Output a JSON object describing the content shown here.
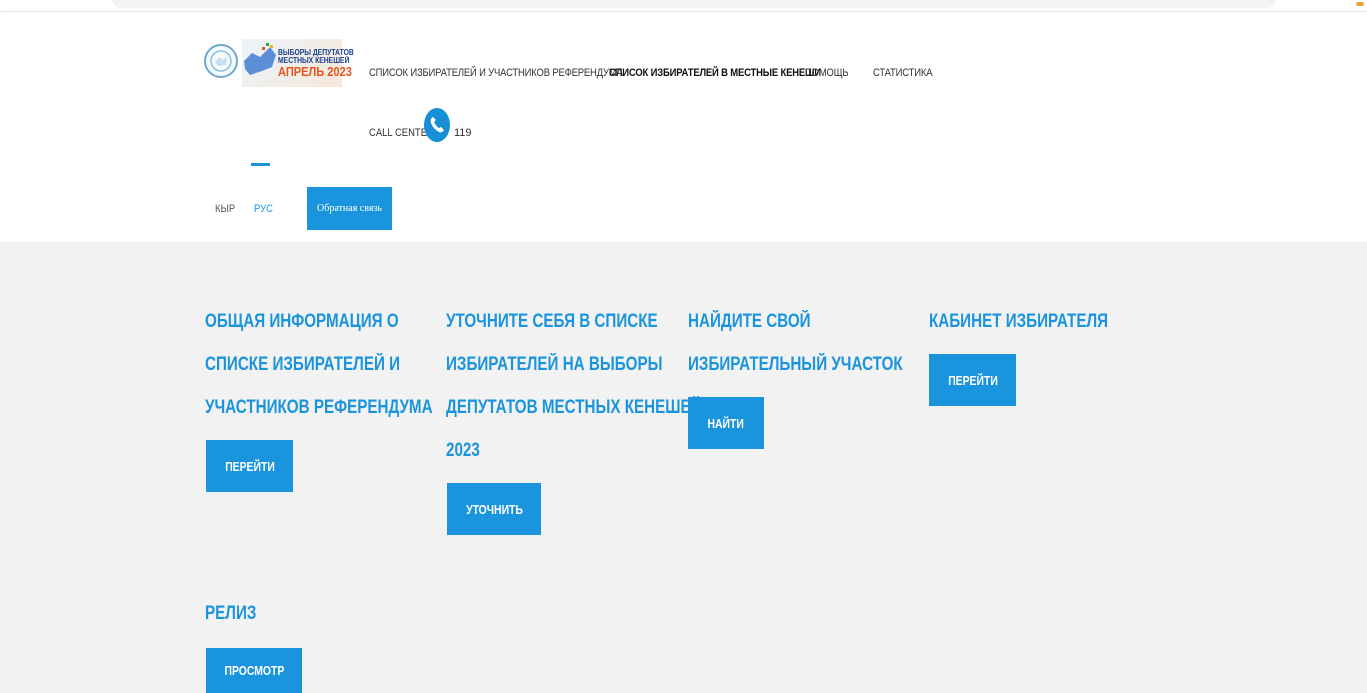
{
  "logo": {
    "line1": "ВЫБОРЫ ДЕПУТАТОВ",
    "line2": "МЕСТНЫХ КЕНЕШЕЙ",
    "line3": "АПРЕЛЬ 2023"
  },
  "nav": {
    "items": [
      "СПИСОК ИЗБИРАТЕЛЕЙ И УЧАСТНИКОВ РЕФЕРЕНДУМА",
      "СПИСОК ИЗБИРАТЕЛЕЙ В МЕСТНЫЕ КЕНЕШИ",
      "ПОМОЩЬ",
      "СТАТИСТИКА"
    ],
    "active_index": 1
  },
  "callcenter": {
    "label": "CALL CENTER",
    "number": "119"
  },
  "languages": [
    "КЫР",
    "РУС"
  ],
  "active_language": "РУС",
  "feedback_label": "Обратная связь",
  "cards": {
    "general_info": {
      "title_lines": [
        "ОБЩАЯ ИНФОРМАЦИЯ О",
        "СПИСКЕ ИЗБИРАТЕЛЕЙ И",
        "УЧАСТНИКОВ РЕФЕРЕНДУМА"
      ],
      "button": "ПЕРЕЙТИ"
    },
    "check_yourself": {
      "title_lines": [
        "УТОЧНИТЕ СЕБЯ В СПИСКЕ",
        "ИЗБИРАТЕЛЕЙ НА ВЫБОРЫ",
        "ДЕПУТАТОВ МЕСТНЫХ КЕНЕШЕЙ",
        "2023"
      ],
      "button": "УТОЧНИТЬ"
    },
    "find_precinct": {
      "title_lines": [
        "НАЙДИТЕ СВОЙ",
        "ИЗБИРАТЕЛЬНЫЙ УЧАСТОК"
      ],
      "button": "НАЙТИ"
    },
    "voter_cabinet": {
      "title_lines": [
        "КАБИНЕТ ИЗБИРАТЕЛЯ"
      ],
      "button": "ПЕРЕЙТИ"
    },
    "release": {
      "title_lines": [
        "РЕЛИЗ"
      ],
      "button": "ПРОСМОТР"
    }
  },
  "colors": {
    "accent": "#1a94dd",
    "background": "#f2f2f2",
    "logo_orange": "#e25620"
  }
}
